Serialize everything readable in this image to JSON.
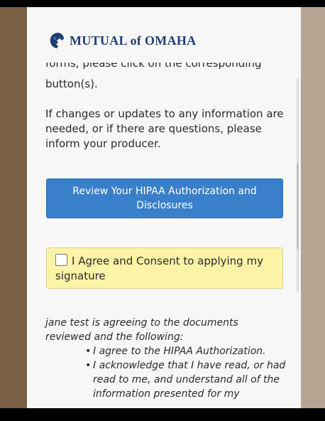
{
  "brand": {
    "name": "MUTUAL of OMAHA"
  },
  "content": {
    "cut_line": "forms, please click on the corresponding blue",
    "buttons_line": "button(s).",
    "info": "If changes or updates to any information are needed, or if there are questions, please inform your producer."
  },
  "review_button": {
    "label": "Review Your HIPAA Authorization and Disclosures"
  },
  "consent": {
    "label": "I Agree and Consent to applying my signature",
    "checked": false
  },
  "agreement": {
    "intro": "jane test is agreeing to the documents reviewed and the following:",
    "bullets": [
      "I agree to the HIPAA Authorization.",
      "I acknowledge that I have read, or had read to me, and understand all of the information presented for my"
    ]
  },
  "colors": {
    "primary_button": "#3a7fc9",
    "consent_bg": "#fbf3a6",
    "brand": "#1f3f73"
  },
  "icons": {
    "logo": "lion-head-icon",
    "checkbox": "checkbox-icon"
  }
}
